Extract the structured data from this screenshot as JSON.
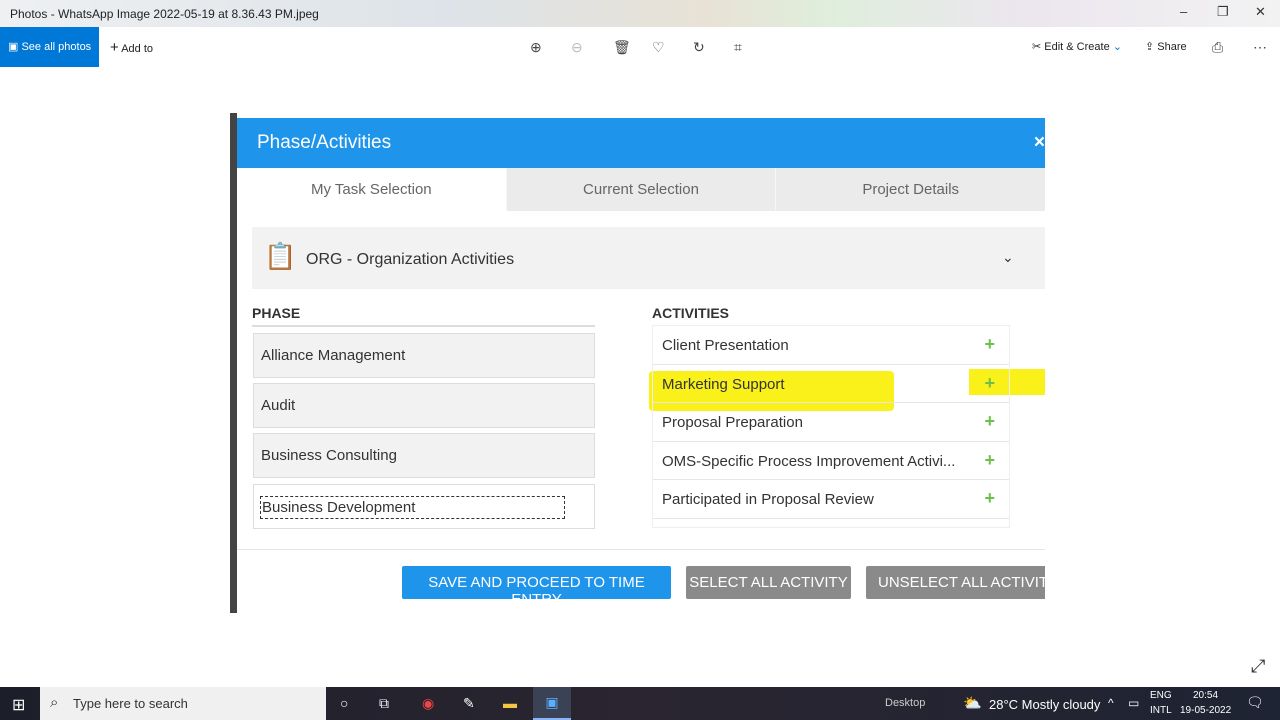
{
  "window": {
    "title": "Photos - WhatsApp Image 2022-05-19 at 8.36.43 PM.jpeg"
  },
  "toolbar": {
    "see_all": "See all photos",
    "add_to": "Add to",
    "edit_create": "Edit & Create",
    "share": "Share"
  },
  "dialog": {
    "title": "Phase/Activities",
    "close": "×",
    "tabs": [
      "My Task Selection",
      "Current Selection",
      "Project Details"
    ],
    "project": "ORG - Organization Activities",
    "phase_header": "PHASE",
    "activities_header": "ACTIVITIES",
    "phases": [
      "Alliance Management",
      "Audit",
      "Business Consulting",
      "Business Development"
    ],
    "activities": [
      "Client Presentation",
      "Marketing Support",
      "Proposal Preparation",
      "OMS-Specific Process Improvement Activi...",
      "Participated in Proposal Review"
    ],
    "buttons": {
      "save": "SAVE AND PROCEED TO TIME ENTRY",
      "select_all": "SELECT ALL ACTIVITY",
      "unselect_all": "UNSELECT ALL ACTIVITY"
    },
    "colors": {
      "header": "#1e94ea",
      "plus": "#6cc04a",
      "highlight": "#f8f000"
    }
  },
  "taskbar": {
    "search_placeholder": "Type here to search",
    "desktop": "Desktop",
    "weather": "28°C  Mostly cloudy",
    "lang1": "ENG",
    "lang2": "INTL",
    "time": "20:54",
    "date": "19-05-2022"
  }
}
